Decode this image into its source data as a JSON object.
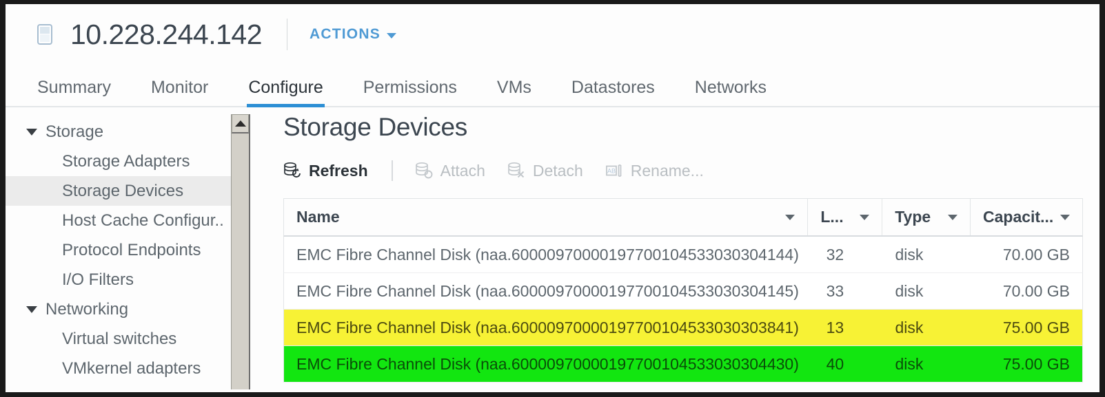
{
  "header": {
    "host_icon": "host-icon",
    "title": "10.228.244.142",
    "actions_label": "ACTIONS",
    "actions_chevron": "chevron-down-icon"
  },
  "tabs": [
    {
      "label": "Summary",
      "active": false
    },
    {
      "label": "Monitor",
      "active": false
    },
    {
      "label": "Configure",
      "active": true
    },
    {
      "label": "Permissions",
      "active": false
    },
    {
      "label": "VMs",
      "active": false
    },
    {
      "label": "Datastores",
      "active": false
    },
    {
      "label": "Networks",
      "active": false
    }
  ],
  "sidebar": {
    "groups": [
      {
        "label": "Storage",
        "items": [
          {
            "label": "Storage Adapters",
            "selected": false
          },
          {
            "label": "Storage Devices",
            "selected": true
          },
          {
            "label": "Host Cache Configur..",
            "selected": false
          },
          {
            "label": "Protocol Endpoints",
            "selected": false
          },
          {
            "label": "I/O Filters",
            "selected": false
          }
        ]
      },
      {
        "label": "Networking",
        "items": [
          {
            "label": "Virtual switches",
            "selected": false
          },
          {
            "label": "VMkernel adapters",
            "selected": false
          }
        ]
      }
    ]
  },
  "main": {
    "page_title": "Storage Devices",
    "toolbar": [
      {
        "label": "Refresh",
        "icon": "refresh-disk-icon",
        "enabled": true
      },
      {
        "label": "Attach",
        "icon": "attach-disk-icon",
        "enabled": false
      },
      {
        "label": "Detach",
        "icon": "detach-disk-icon",
        "enabled": false
      },
      {
        "label": "Rename...",
        "icon": "rename-icon",
        "enabled": false
      }
    ],
    "table": {
      "columns": [
        {
          "label": "Name",
          "key": "name"
        },
        {
          "label": "L...",
          "key": "lun"
        },
        {
          "label": "Type",
          "key": "type"
        },
        {
          "label": "Capacit...",
          "key": "capacity"
        }
      ],
      "rows": [
        {
          "name": "EMC Fibre Channel Disk (naa.60000970000197700104533030304144)",
          "lun": "32",
          "type": "disk",
          "capacity": "70.00 GB",
          "highlight": "none"
        },
        {
          "name": "EMC Fibre Channel Disk (naa.60000970000197700104533030304145)",
          "lun": "33",
          "type": "disk",
          "capacity": "70.00 GB",
          "highlight": "none"
        },
        {
          "name": "EMC Fibre Channel Disk (naa.60000970000197700104533030303841)",
          "lun": "13",
          "type": "disk",
          "capacity": "75.00 GB",
          "highlight": "yellow"
        },
        {
          "name": "EMC Fibre Channel Disk (naa.60000970000197700104533030304430)",
          "lun": "40",
          "type": "disk",
          "capacity": "75.00 GB",
          "highlight": "green"
        }
      ]
    }
  },
  "scrollbar": {
    "up_arrow": "scroll-up-arrow-icon"
  },
  "colors": {
    "accent": "#2d8fd5",
    "link": "#4f9ad4",
    "highlight_yellow": "#f7f235",
    "highlight_green": "#12e610"
  }
}
